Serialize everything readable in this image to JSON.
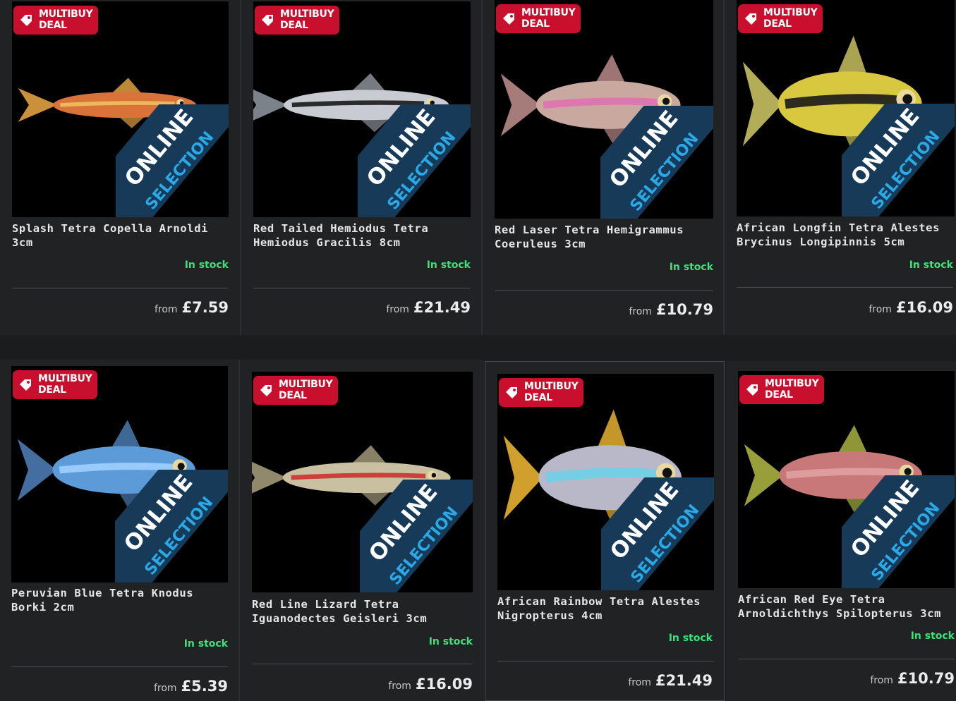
{
  "badge": {
    "line1": "MULTIBUY",
    "line2": "DEAL"
  },
  "ribbon": {
    "line1": "ONLINE",
    "line2": "SELECTION"
  },
  "price_prefix": "from",
  "colors": {
    "badge": "#c8102e",
    "stock": "#3ee07a",
    "ribbon": "#163a58",
    "ribbon_text": "#2ba8e6"
  },
  "products": [
    {
      "title": "Splash Tetra Copella Arnoldi 3cm",
      "stock": "In stock",
      "price": "£7.59"
    },
    {
      "title": "Red Tailed Hemiodus Tetra Hemiodus Gracilis 8cm",
      "stock": "In stock",
      "price": "£21.49"
    },
    {
      "title": "Red Laser Tetra Hemigrammus Coeruleus 3cm",
      "stock": "In stock",
      "price": "£10.79"
    },
    {
      "title": "African Longfin Tetra Alestes Brycinus Longipinnis 5cm",
      "stock": "In stock",
      "price": "£16.09"
    },
    {
      "title": "Peruvian Blue Tetra Knodus Borki 2cm",
      "stock": "In stock",
      "price": "£5.39"
    },
    {
      "title": "Red Line Lizard Tetra Iguanodectes Geisleri 3cm",
      "stock": "In stock",
      "price": "£16.09"
    },
    {
      "title": "African Rainbow Tetra Alestes Nigropterus 4cm",
      "stock": "In stock",
      "price": "£21.49"
    },
    {
      "title": "African Red Eye Tetra Arnoldichthys Spilopterus 3cm",
      "stock": "In stock",
      "price": "£10.79"
    }
  ]
}
